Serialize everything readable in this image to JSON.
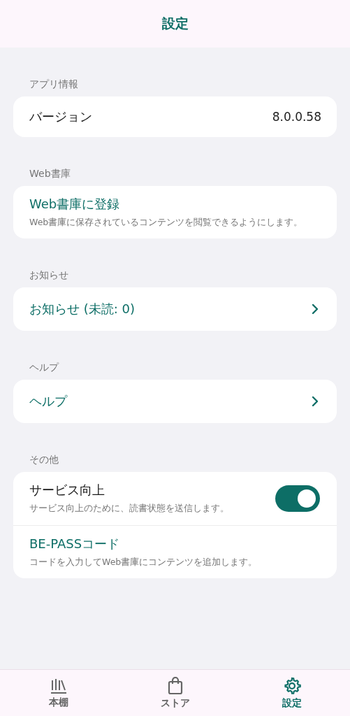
{
  "header": {
    "title": "設定"
  },
  "sections": [
    {
      "label": "アプリ情報",
      "items": [
        {
          "kind": "info",
          "title": "バージョン",
          "value": "8.0.0.58"
        }
      ]
    },
    {
      "label": "Web書庫",
      "items": [
        {
          "kind": "link",
          "title": "Web書庫に登録",
          "description": "Web書庫に保存されているコンテンツを閲覧できるようにします。"
        }
      ]
    },
    {
      "label": "お知らせ",
      "items": [
        {
          "kind": "nav",
          "title": "お知らせ (未読: 0)"
        }
      ]
    },
    {
      "label": "ヘルプ",
      "items": [
        {
          "kind": "nav",
          "title": "ヘルプ"
        }
      ]
    },
    {
      "label": "その他",
      "items": [
        {
          "kind": "toggle",
          "title": "サービス向上",
          "description": "サービス向上のために、読書状態を送信します。",
          "on": true
        },
        {
          "kind": "link",
          "title": "BE-PASSコード",
          "description": "コードを入力してWeb書庫にコンテンツを追加します。"
        }
      ]
    }
  ],
  "bottom_nav": [
    {
      "label": "本棚",
      "selected": false
    },
    {
      "label": "ストア",
      "selected": false
    },
    {
      "label": "設定",
      "selected": true
    }
  ]
}
